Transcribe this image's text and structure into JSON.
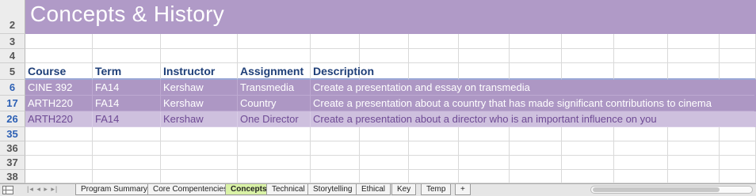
{
  "title": "Concepts & History",
  "header": {
    "course": "Course",
    "term": "Term",
    "instructor": "Instructor",
    "assignment": "Assignment",
    "description": "Description"
  },
  "row_numbers": {
    "title": "2",
    "r3": "3",
    "r4": "4",
    "header": "5",
    "empty1": "35",
    "empty2": "36",
    "empty3": "37",
    "empty4": "38"
  },
  "rows": [
    {
      "num": "6",
      "course": "CINE 392",
      "term": "FA14",
      "instructor": "Kershaw",
      "assignment": "Transmedia",
      "description": "Create a presentation and essay on transmedia"
    },
    {
      "num": "17",
      "course": "ARTH220",
      "term": "FA14",
      "instructor": "Kershaw",
      "assignment": "Country",
      "description": "Create a presentation about a country that has made significant contributions to cinema"
    },
    {
      "num": "26",
      "course": "ARTH220",
      "term": "FA14",
      "instructor": "Kershaw",
      "assignment": "One Director",
      "description": "Create a presentation about a director who is an important influence on you"
    }
  ],
  "tabs": {
    "nav": "|◂ ◂ ▸ ▸|",
    "t1": "Program Summary",
    "t2": "Core Compentencies",
    "t3": "Concepts",
    "t4": "Technical",
    "t5": "Storytelling",
    "t6": "Ethical",
    "t7": "Key",
    "t8": "Temp",
    "add": "+"
  },
  "colors": {
    "title_bg": "#b09ac7",
    "dark_row": "#ad97c4",
    "light_row": "#cec0de",
    "active_tab": "#d9f2a6",
    "header_text": "#1f3f78"
  }
}
